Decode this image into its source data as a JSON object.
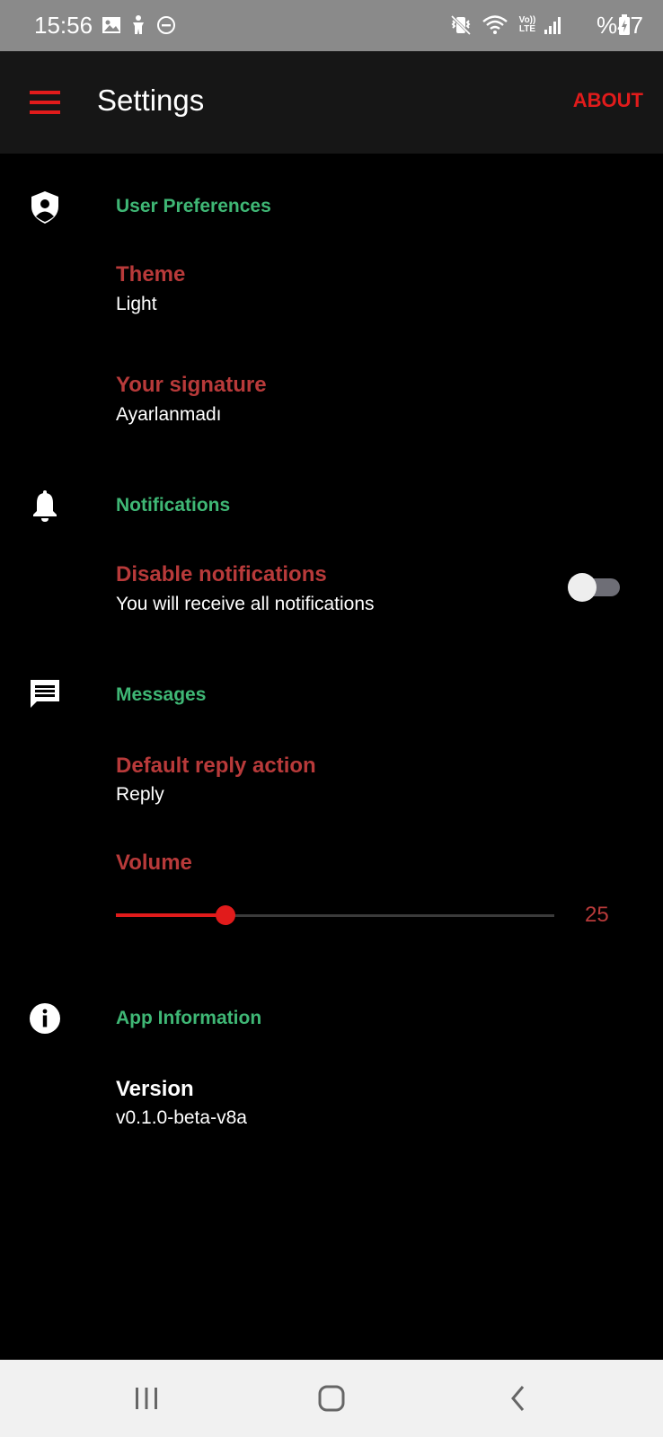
{
  "status_bar": {
    "time": "15:56",
    "battery": "%47",
    "icons": [
      "image-icon",
      "accessibility-icon",
      "do-not-disturb-icon",
      "vibrate-icon",
      "wifi-icon",
      "volte-icon",
      "signal-icon",
      "battery-charging-icon"
    ],
    "volte_label": "Vo)) LTE"
  },
  "app_bar": {
    "title": "Settings",
    "about_label": "ABOUT",
    "menu_icon": "menu-icon"
  },
  "colors": {
    "accent": "#e11b1b",
    "section_title": "#3fb775",
    "pref_title": "#b83a3a",
    "app_bar_bg": "#161616",
    "status_bar_bg": "#8a8a8a"
  },
  "sections": {
    "user_preferences": {
      "title": "User Preferences",
      "icon": "shield-user-icon",
      "theme": {
        "title": "Theme",
        "summary": "Light"
      },
      "signature": {
        "title": "Your signature",
        "summary": "Ayarlanmadı"
      }
    },
    "notifications": {
      "title": "Notifications",
      "icon": "bell-icon",
      "disable": {
        "title": "Disable notifications",
        "summary": "You will receive all notifications",
        "enabled": false
      }
    },
    "messages": {
      "title": "Messages",
      "icon": "message-icon",
      "reply": {
        "title": "Default reply action",
        "summary": "Reply"
      },
      "volume": {
        "title": "Volume",
        "value": "25",
        "max": 100
      }
    },
    "app_information": {
      "title": "App Information",
      "icon": "info-icon",
      "version": {
        "title": "Version",
        "summary": "v0.1.0-beta-v8a"
      }
    }
  },
  "nav_bar": {
    "icons": [
      "recent-apps-icon",
      "home-icon",
      "back-icon"
    ]
  }
}
